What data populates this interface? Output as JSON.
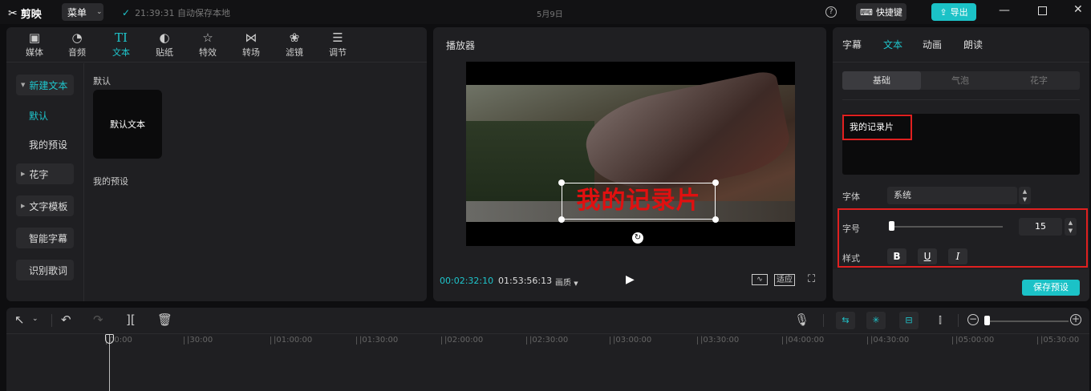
{
  "topbar": {
    "app_name": "剪映",
    "menu_label": "菜单",
    "save_status": "21:39:31 自动保存本地",
    "date": "5月9日",
    "help_glyph": "?",
    "shortcut_label": "快捷键",
    "export_label": "导出"
  },
  "media_tabs": [
    {
      "label": "媒体",
      "icon": "media-icon"
    },
    {
      "label": "音频",
      "icon": "audio-icon"
    },
    {
      "label": "文本",
      "icon": "text-icon",
      "active": true
    },
    {
      "label": "贴纸",
      "icon": "sticker-icon"
    },
    {
      "label": "特效",
      "icon": "effects-icon"
    },
    {
      "label": "转场",
      "icon": "transition-icon"
    },
    {
      "label": "滤镜",
      "icon": "filter-icon"
    },
    {
      "label": "调节",
      "icon": "adjust-icon"
    }
  ],
  "text_nav": {
    "new_text": "新建文本",
    "default": "默认",
    "my_presets": "我的预设",
    "fancy_text": "花字",
    "text_template": "文字模板",
    "smart_caption": "智能字幕",
    "lyrics": "识别歌词"
  },
  "text_library": {
    "section_default": "默认",
    "card_label": "默认文本",
    "section_presets": "我的预设"
  },
  "player": {
    "title": "播放器",
    "caption": "我的记录片",
    "current_time": "00:02:32:10",
    "total_time": "01:53:56:13",
    "quality": "画质",
    "fit_label": "适应"
  },
  "inspector": {
    "tabs": [
      "字幕",
      "文本",
      "动画",
      "朗读"
    ],
    "active_tab": "文本",
    "sub_tabs": [
      "基础",
      "气泡",
      "花字"
    ],
    "text_value": "我的记录片",
    "font_label": "字体",
    "font_value": "系统",
    "size_label": "字号",
    "size_value": "15",
    "size_slider_fraction": 0.02,
    "style_label": "样式",
    "style_bold": "B",
    "style_underline": "U",
    "style_italic": "I",
    "save_preset": "保存预设"
  },
  "timeline": {
    "ticks": [
      "00:00",
      "|30:00",
      "|01:00:00",
      "|01:30:00",
      "|02:00:00",
      "|02:30:00",
      "|03:00:00",
      "|03:30:00",
      "|04:00:00",
      "|04:30:00",
      "|05:00:00",
      "|05:30:00"
    ]
  },
  "colors": {
    "accent": "#1fc5cc",
    "highlight_box": "#e02020",
    "caption_text": "#e01010"
  }
}
